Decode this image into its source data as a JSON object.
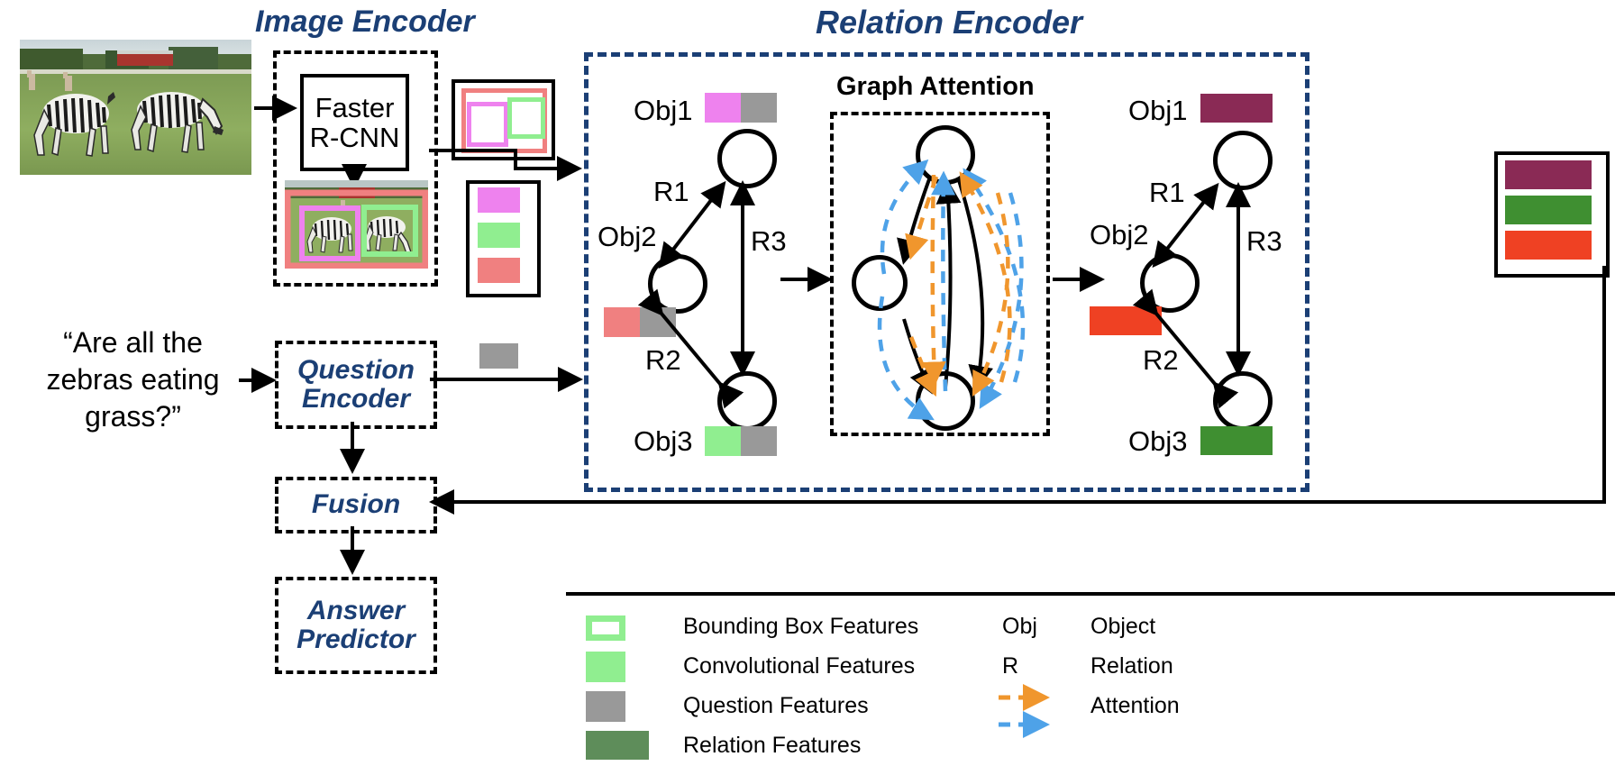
{
  "titles": {
    "image_encoder": "Image Encoder",
    "relation_encoder": "Relation Encoder",
    "graph_attention": "Graph Attention"
  },
  "blocks": {
    "faster_rcnn_line1": "Faster",
    "faster_rcnn_line2": "R-CNN",
    "question_encoder_line1": "Question",
    "question_encoder_line2": "Encoder",
    "fusion": "Fusion",
    "answer_predictor_line1": "Answer",
    "answer_predictor_line2": "Predictor"
  },
  "question": {
    "line1": "“Are all the",
    "line2": "zebras eating",
    "line3": "grass?”"
  },
  "graph_left": {
    "obj1": "Obj1",
    "obj2": "Obj2",
    "obj3": "Obj3",
    "r1": "R1",
    "r2": "R2",
    "r3": "R3"
  },
  "graph_right": {
    "obj1": "Obj1",
    "obj2": "Obj2",
    "obj3": "Obj3",
    "r1": "R1",
    "r2": "R2",
    "r3": "R3"
  },
  "legend": {
    "items": [
      {
        "swatch": "bounding-box-swatch",
        "label": "Bounding Box  Features",
        "color": "#90ee90"
      },
      {
        "swatch": "convolutional-swatch",
        "label": "Convolutional  Features",
        "color": "#90ee90"
      },
      {
        "swatch": "question-swatch",
        "label": "Question  Features",
        "color": "#999999"
      },
      {
        "swatch": "relation-swatch",
        "label": "Relation  Features",
        "color": "#5e8d5a"
      }
    ],
    "abbrevs": [
      {
        "key": "Obj",
        "value": "Object"
      },
      {
        "key": "R",
        "value": "Relation"
      }
    ],
    "attention": {
      "label": "Attention",
      "color_orange": "#f0962d",
      "color_blue": "#4ea2e8"
    }
  },
  "colors": {
    "navy": "#1b3f75",
    "magenta": "#ee82ee",
    "lightgreen": "#90ee90",
    "salmon": "#f08080",
    "gray": "#999999",
    "maroon": "#8a2a55",
    "green": "#3f8f31",
    "orangered": "#ef4123",
    "attention_orange": "#f0962d",
    "attention_blue": "#4ea2e8"
  }
}
